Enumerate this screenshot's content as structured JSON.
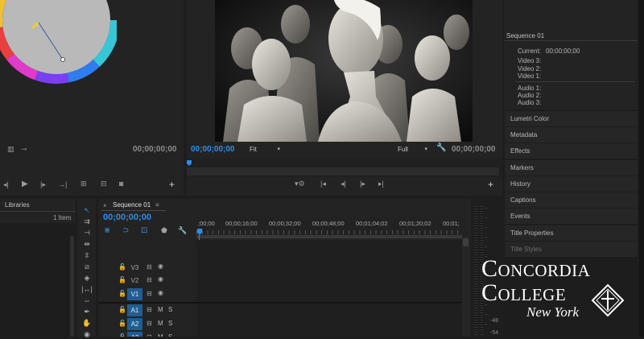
{
  "colors": {
    "timecode_blue": "#2d8ceb",
    "panel_bg": "#232323",
    "track_active": "#1f5d92",
    "playhead": "#2d8ceb"
  },
  "source_monitor": {
    "timecode": "00;00;00;00"
  },
  "program_monitor": {
    "current_timecode": "00;00;00;00",
    "fit_label": "Fit",
    "resolution_label": "Full",
    "duration_timecode": "00;00;00;00"
  },
  "info_panel": {
    "sequence_title": "Sequence 01",
    "current_label": "Current:",
    "current_value": "00;00;00;00",
    "video_tracks": [
      "Video 3:",
      "Video 2:",
      "Video 1:"
    ],
    "audio_tracks": [
      "Audio 1:",
      "Audio 2:",
      "Audio 3:"
    ]
  },
  "side_panels": [
    {
      "label": "Lumetri Color"
    },
    {
      "label": "Metadata"
    },
    {
      "label": "Effects"
    },
    {
      "label": "Markers"
    },
    {
      "label": "History"
    },
    {
      "label": "Captions"
    },
    {
      "label": "Events"
    },
    {
      "label": "Title Properties"
    },
    {
      "label": "Title Styles"
    }
  ],
  "libraries": {
    "title": "Libraries",
    "count": "1 Item"
  },
  "timeline": {
    "sequence_tab": "Sequence 01",
    "timecode": "00;00;00;00",
    "ruler_labels": [
      ";00;00",
      "00;00;16;00",
      "00;00;32;00",
      "00;00;48;00",
      "00;01;04;02",
      "00;01;20;02",
      "00;01;"
    ],
    "tracks": [
      {
        "name": "V3",
        "active": false
      },
      {
        "name": "V2",
        "active": false
      },
      {
        "name": "V1",
        "active": true
      },
      {
        "name": "A1",
        "active": true
      },
      {
        "name": "A2",
        "active": true
      },
      {
        "name": "A3",
        "active": true
      }
    ],
    "mute_label": "M",
    "solo_label": "S"
  },
  "audio_meter": {
    "labels": [
      "-48",
      "-54"
    ]
  },
  "watermark": {
    "line1": "Concordia",
    "line2": "College",
    "line3": "New York"
  }
}
